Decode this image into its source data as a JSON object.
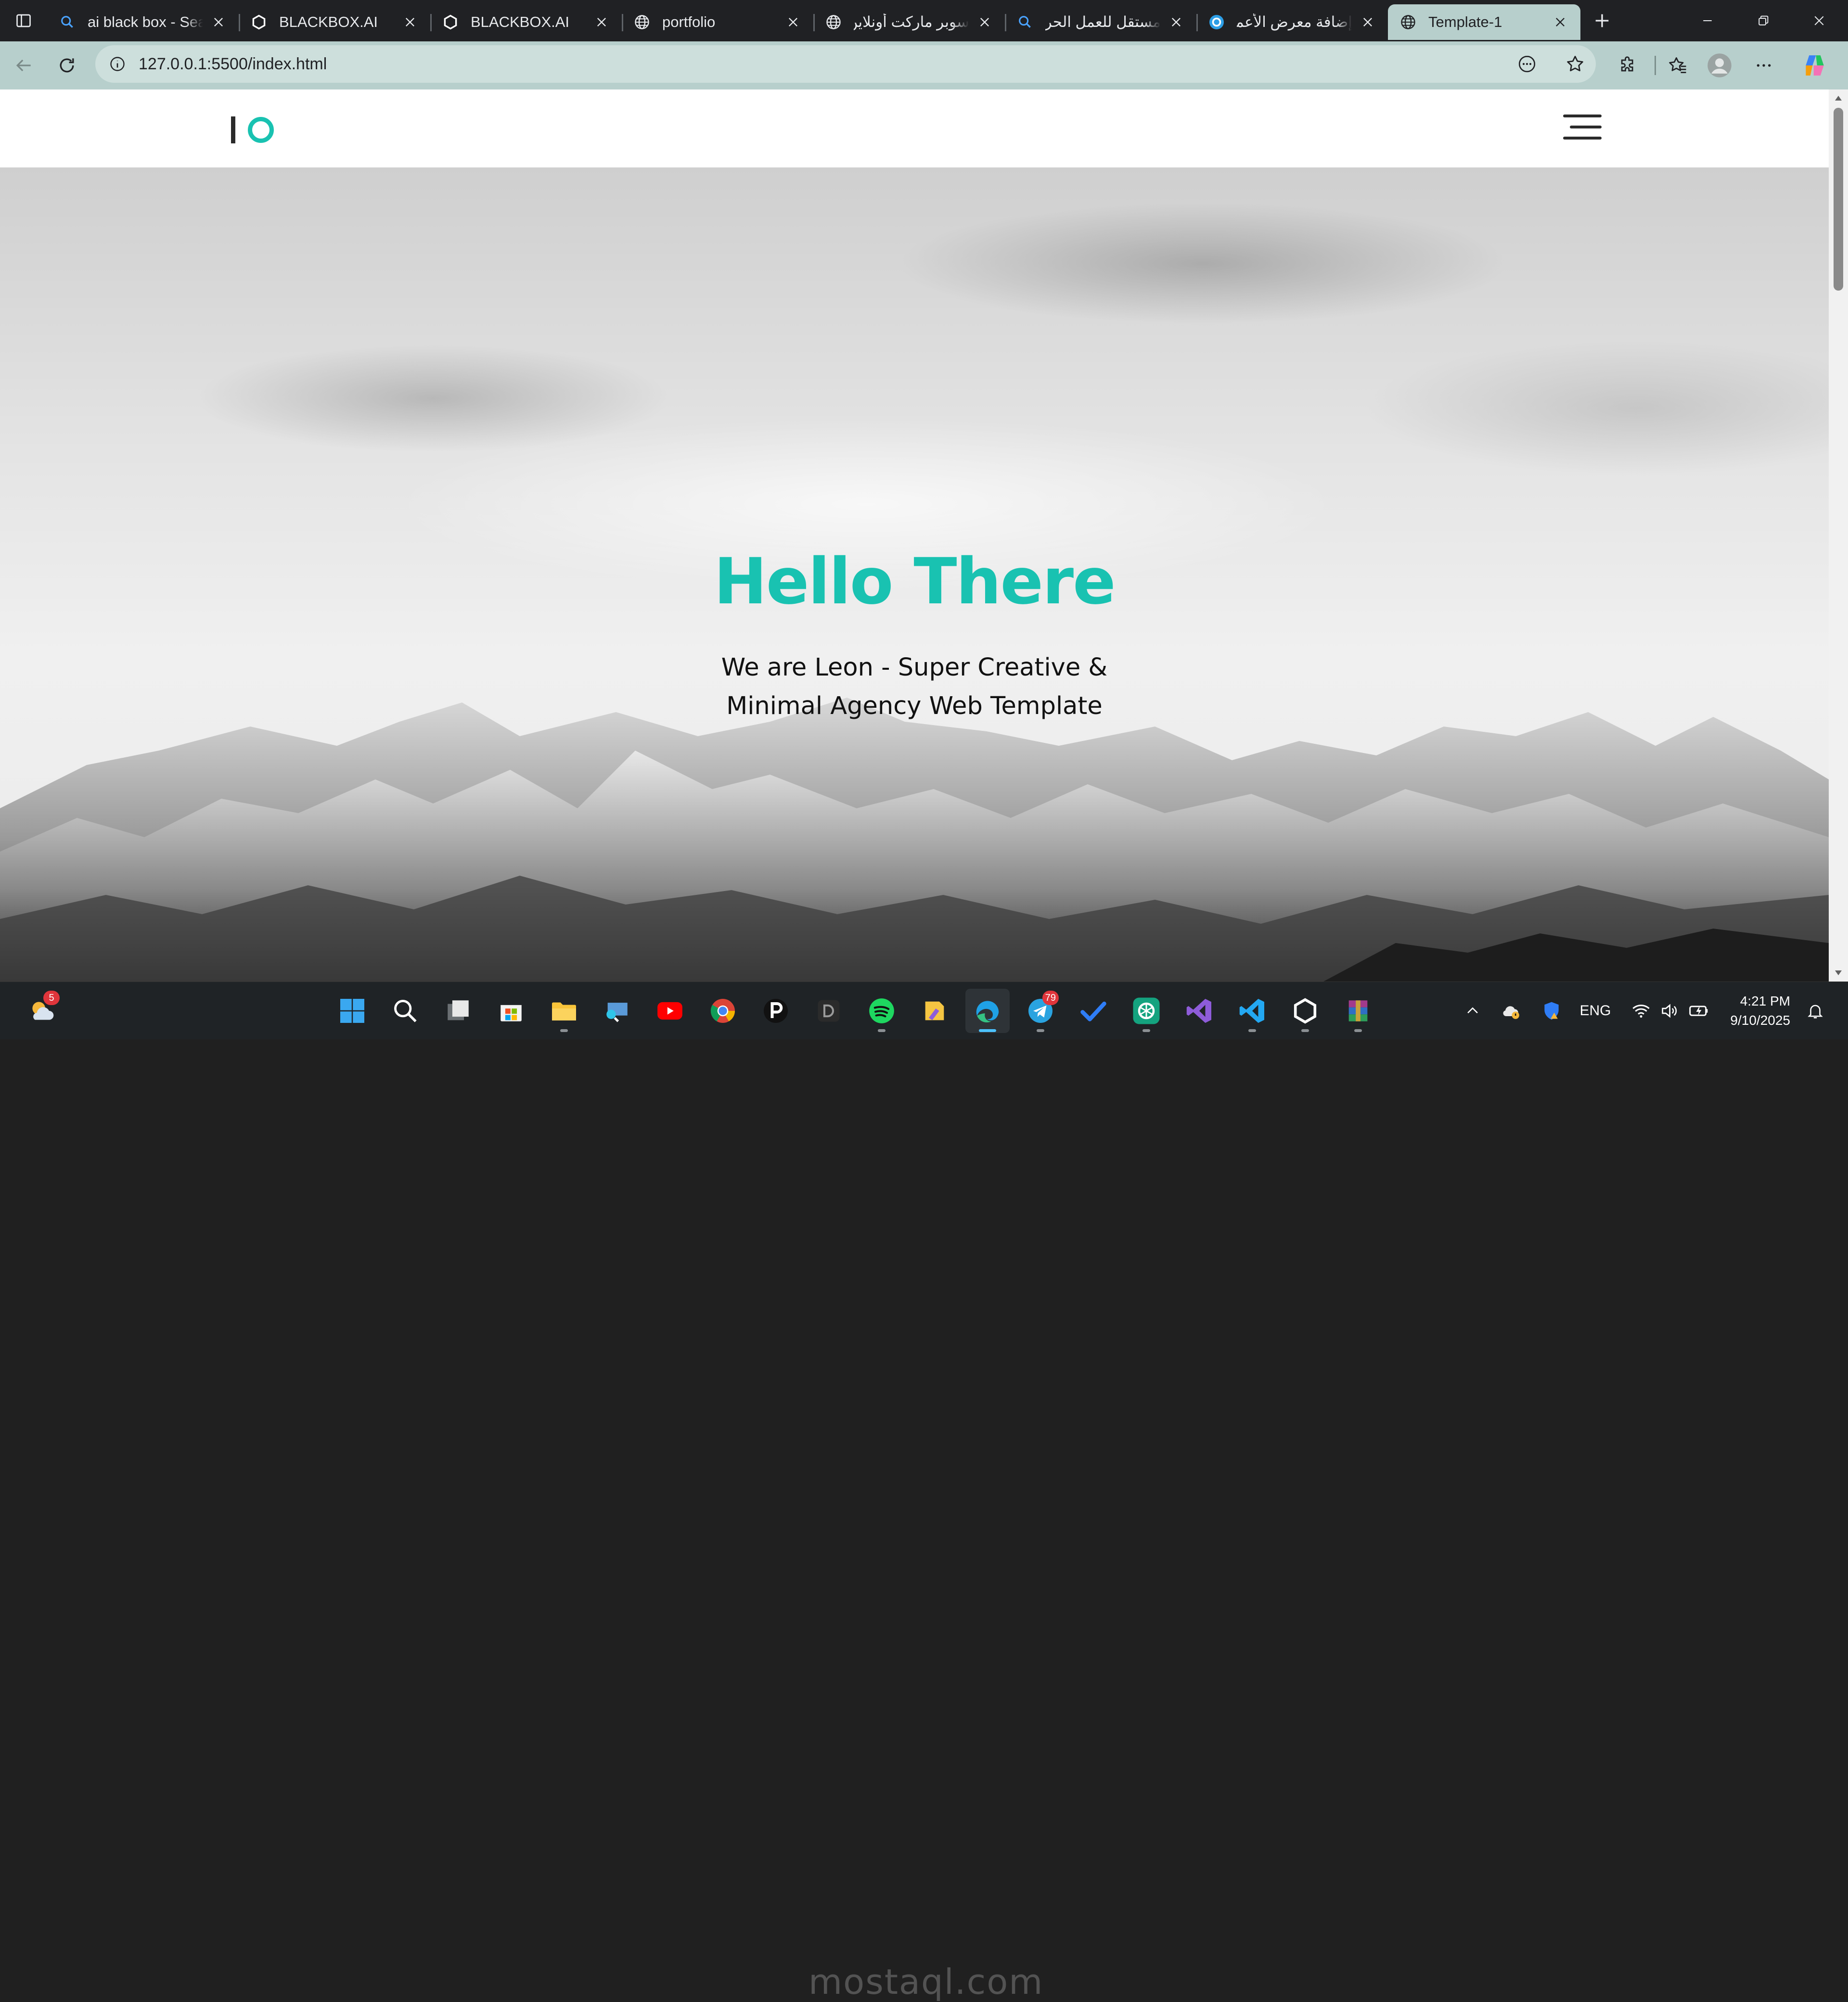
{
  "browser": {
    "tabs": [
      {
        "title": "ai black box - Search",
        "icon": "search-icon",
        "rtl": false,
        "active": false
      },
      {
        "title": "BLACKBOX.AI",
        "icon": "blackbox-logo-icon",
        "rtl": false,
        "active": false
      },
      {
        "title": "BLACKBOX.AI",
        "icon": "blackbox-logo-icon",
        "rtl": false,
        "active": false
      },
      {
        "title": "portfolio",
        "icon": "globe-icon",
        "rtl": false,
        "active": false
      },
      {
        "title": "سوبر ماركت أونلاين",
        "icon": "globe-icon",
        "rtl": true,
        "active": false
      },
      {
        "title": "مستقل للعمل الحر -",
        "icon": "search-icon",
        "rtl": true,
        "active": false
      },
      {
        "title": "إضافة معرض الأعمال",
        "icon": "mostaql-icon",
        "rtl": true,
        "active": false
      },
      {
        "title": "Template-1",
        "icon": "globe-icon",
        "rtl": false,
        "active": true
      }
    ],
    "url": "127.0.0.1:5500/index.html",
    "accent": "#b7cfcc"
  },
  "site": {
    "hero_title": "Hello There",
    "hero_subtitle": "We are Leon - Super Creative & Minimal Agency Web Template",
    "brand_color": "#19c2b1"
  },
  "taskbar": {
    "weather_badge": "5",
    "telegram_badge": "79",
    "watermark": "mostaql.com",
    "language": "ENG",
    "time": "4:21 PM",
    "date": "9/10/2025"
  }
}
